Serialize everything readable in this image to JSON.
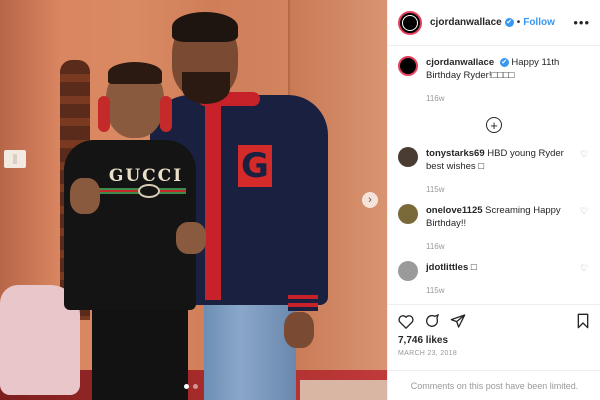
{
  "header": {
    "username": "cjordanwallace",
    "verified_mark": "✔",
    "separator": "•",
    "follow_label": "Follow",
    "more_label": "•••"
  },
  "caption": {
    "username": "cjordanwallace",
    "verified_mark": "✔",
    "text": "Happy 11th Birthday Ryder!□□□□",
    "age": "116w"
  },
  "load_more_icon": "plus-circle-icon",
  "comments": [
    {
      "username": "tonystarks69",
      "text": "HBD young Ryder best wishes □",
      "age": "115w",
      "avatar_color": "#4a3b33"
    },
    {
      "username": "onelove1125",
      "text": "Screaming Happy Birthday!!",
      "age": "116w",
      "avatar_color": "#7a6a3a"
    },
    {
      "username": "jdotlittles",
      "text": "□",
      "age": "115w",
      "avatar_color": "#9a9a9a"
    }
  ],
  "actions": {
    "icons": [
      "heart-icon",
      "comment-icon",
      "share-icon",
      "bookmark-icon"
    ],
    "likes": "7,746 likes",
    "date": "MARCH 23, 2018"
  },
  "footer": {
    "comments_limited": "Comments on this post have been limited."
  },
  "photo": {
    "shirt_text": "GUCCI",
    "jacket_letter": "G",
    "carousel_next": "›",
    "slides": [
      true,
      false
    ]
  },
  "colors": {
    "accent": "#3897f0",
    "story_ring": "#e4405f"
  }
}
